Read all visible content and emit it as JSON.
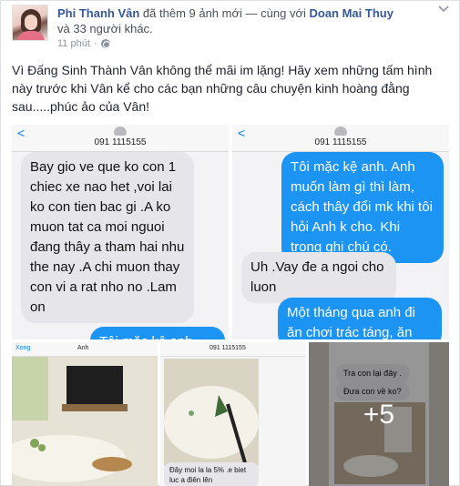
{
  "post": {
    "author": "Phi Thanh Vân",
    "action": "đã thêm 9 ảnh mới",
    "with_prefix": "— cùng với",
    "tagged": "Doan Mai Thuy",
    "and_others": "và 33 người khác.",
    "time": "11 phút",
    "text": "Vì Đấng Sinh Thành Vân không thể mãi im lặng! Hãy xem những tấm hình này trước khi Vân kể cho các bạn những câu chuyện kinh hoàng đằng sau.....phúc ảo của Vân!"
  },
  "icons": {
    "globe": "globe-icon",
    "chevron": "chevron-down-icon",
    "back": "back-chevron-icon"
  },
  "photos": {
    "p1": {
      "back": "<",
      "phone": "091 1115155",
      "bubble_gray": "Bay gio ve que ko con 1 chiec xe nao het ,voi lai ko con tien bac gi .A ko muon tat ca moi nguoi đang thây a tham hai nhu the nay .A chi muon thay con vi a rat nho no .Lam on",
      "bubble_blue": "Tôi mặc kệ anh. Anh"
    },
    "p2": {
      "back": "<",
      "phone": "091 1115155",
      "bubble_blue1": "Tôi mặc kệ anh. Anh muốn làm gì thì làm, cách thây đổi mk khi tôi hỏi Anh k cho. Khi trong ghi chú có.",
      "bubble_gray": "Uh .Vay đe a ngoi cho luon",
      "bubble_blue2": "Một tháng qua anh đi ăn chơi trác táng, ăn"
    },
    "p3": {
      "back": "Xong",
      "title": "Anh"
    },
    "p4": {
      "phone": "091 1115155",
      "bubble": "Đây moi la la 5% .e biet luc a điên lên"
    },
    "p5": {
      "bubble1": "Tra con lại đây .",
      "bubble2": "Đưa con về ko?",
      "more": "+5"
    }
  },
  "colors": {
    "link": "#365899",
    "ios_blue": "#1c94f3",
    "ios_gray": "#e5e5ea"
  }
}
